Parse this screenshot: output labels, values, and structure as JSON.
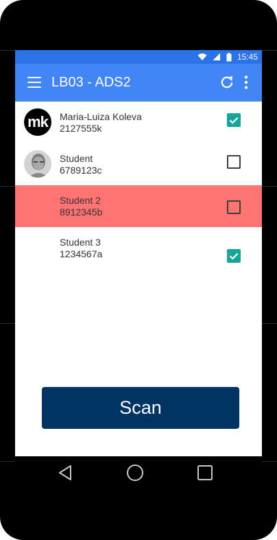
{
  "status_bar": {
    "time": "15:45",
    "icons": [
      "wifi-icon",
      "signal-icon",
      "battery-icon"
    ]
  },
  "app_bar": {
    "title": "LB03 - ADS2",
    "icons": [
      "menu-icon",
      "refresh-icon",
      "more-vert-icon"
    ]
  },
  "students": [
    {
      "name": "Maria-Luiza Koleva",
      "id": "2127555k",
      "avatar": "mk",
      "checked": true,
      "highlight": false
    },
    {
      "name": "Student",
      "id": "6789123c",
      "avatar": "photo",
      "checked": false,
      "highlight": false
    },
    {
      "name": "Student 2",
      "id": "8912345b",
      "avatar": "",
      "checked": false,
      "highlight": true
    },
    {
      "name": "Student 3",
      "id": "1234567a",
      "avatar": "",
      "checked": true,
      "highlight": false
    }
  ],
  "scan_button": {
    "label": "Scan"
  },
  "colors": {
    "app_bar": "#4285f4",
    "status_bar": "#2b73e6",
    "checkbox_checked": "#16a596",
    "absent_row": "#ff7373",
    "scan_button": "#003462"
  },
  "nav_bar": {
    "icons": [
      "back-icon",
      "home-icon",
      "recents-icon"
    ]
  }
}
